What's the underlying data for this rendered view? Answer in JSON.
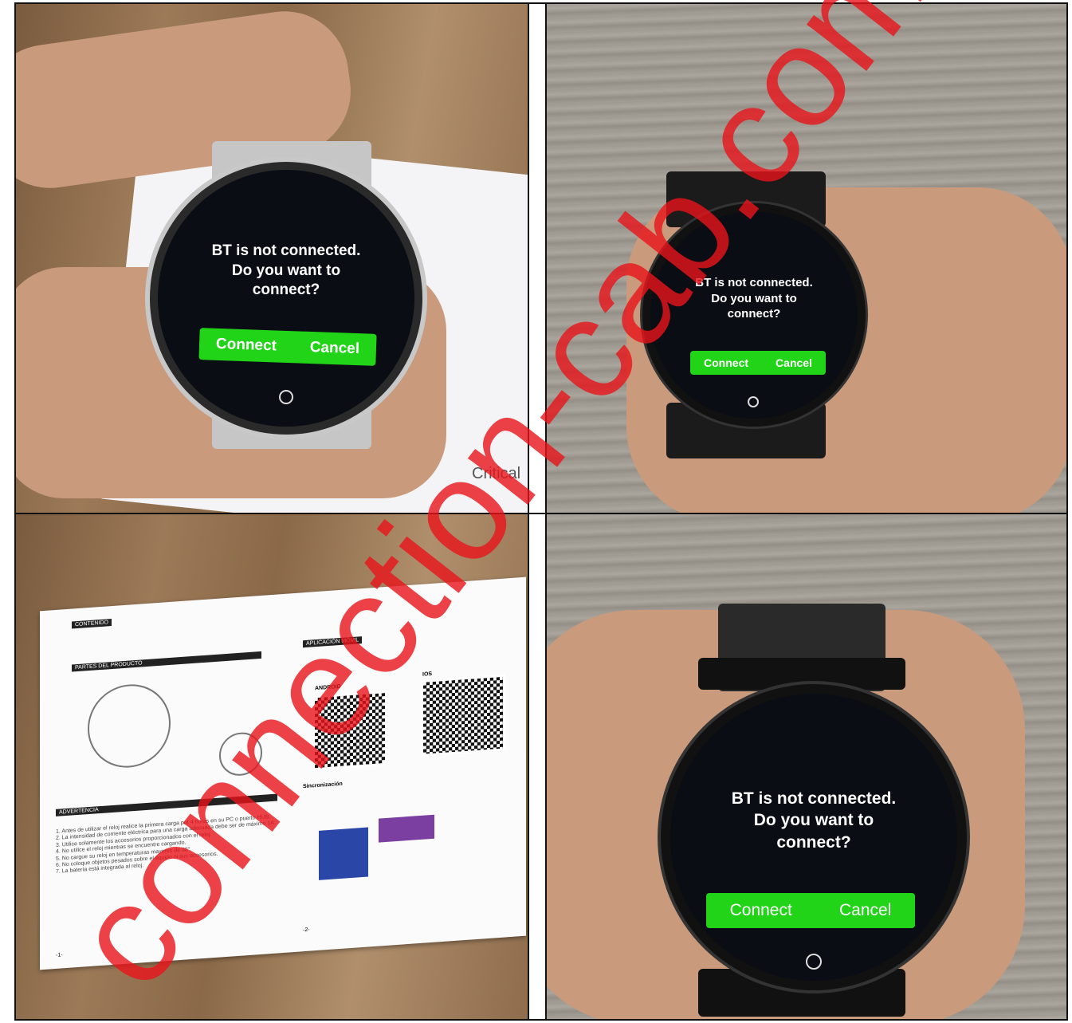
{
  "photos": [
    {
      "screen": {
        "message": "BT is not connected.\nDo you want to\nconnect?",
        "connect_label": "Connect",
        "cancel_label": "Cancel"
      },
      "paper_text": "Critical"
    },
    {
      "screen": {
        "message": "BT is not connected.\nDo you want to\nconnect?",
        "connect_label": "Connect",
        "cancel_label": "Cancel"
      }
    },
    {
      "manual": {
        "contenido": "CONTENIDO",
        "partes": "PARTES DEL PRODUCTO",
        "advertencia": "ADVERTENCIA",
        "aplicacion": "APLICACIÓN MÓVIL",
        "android": "ANDROID",
        "ios": "IOS",
        "sincronizacion": "Sincronización",
        "page_left": "-1-",
        "page_right": "-2-"
      }
    },
    {
      "screen": {
        "message": "BT is not connected.\nDo you want to\nconnect?",
        "connect_label": "Connect",
        "cancel_label": "Cancel"
      }
    }
  ],
  "watermark": {
    "text": "connection-cab.com",
    "color": "#e8141a"
  },
  "colors": {
    "button_green": "#22d418",
    "screen_bg": "#0a0d14"
  }
}
